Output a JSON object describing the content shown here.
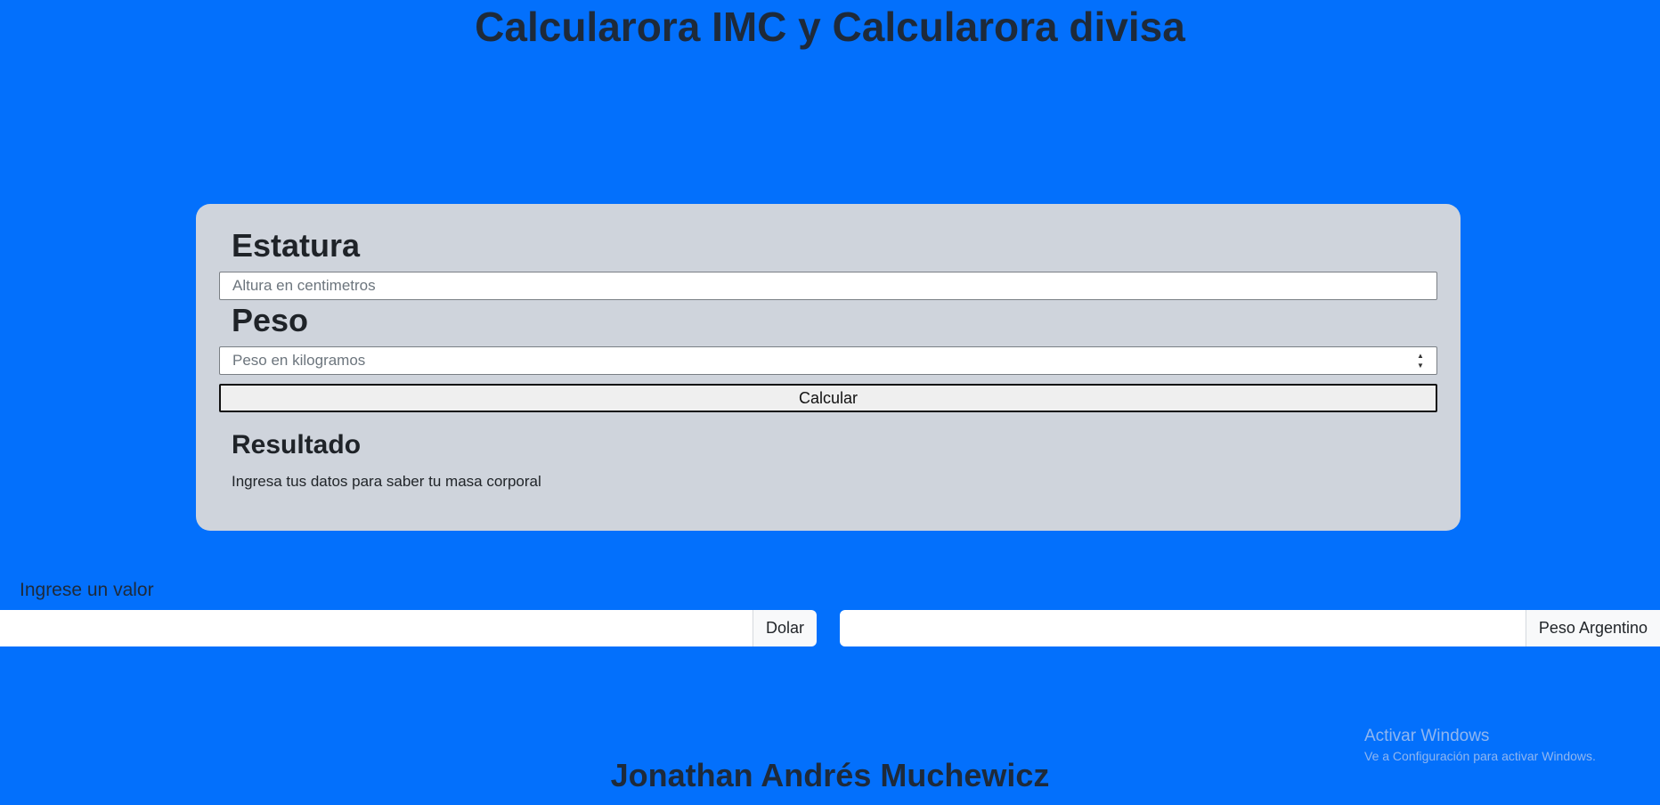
{
  "header": {
    "title": "Calcularora IMC y Calcularora divisa"
  },
  "imc_card": {
    "height_label": "Estatura",
    "height_placeholder": "Altura en centimetros",
    "weight_label": "Peso",
    "weight_placeholder": "Peso en kilogramos",
    "calculate_button": "Calcular",
    "result_title": "Resultado",
    "result_text": "Ingresa tus datos para saber tu masa corporal"
  },
  "currency": {
    "label": "Ingrese un valor",
    "from_currency": "Dolar",
    "to_currency": "Peso Argentino"
  },
  "watermark": {
    "title": "Activar Windows",
    "subtitle": "Ve a Configuración para activar Windows."
  },
  "footer": {
    "author": "Jonathan Andrés Muchewicz"
  },
  "colors": {
    "background": "#0370fc",
    "card": "#cfd4dc"
  }
}
